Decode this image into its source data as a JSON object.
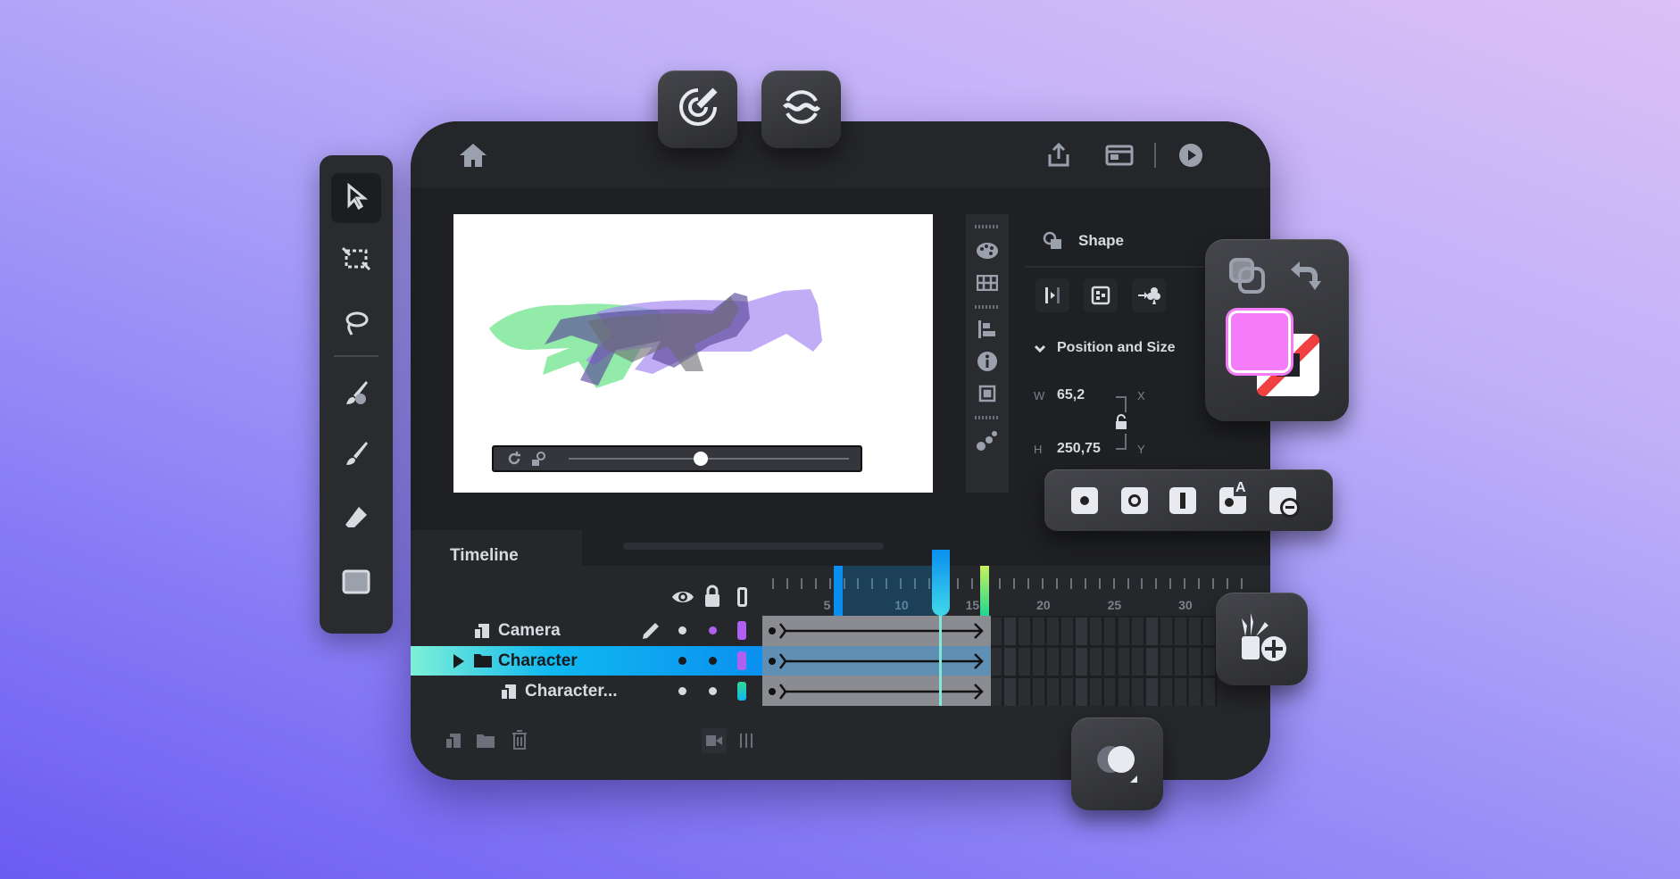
{
  "topbar": {
    "icons": [
      "home-icon",
      "share-icon",
      "window-icon",
      "play-icon"
    ]
  },
  "floating": {
    "top_buttons": [
      "target-pencil-icon",
      "wave-circle-icon"
    ],
    "add_brush_icon": "brush-add-icon",
    "shape_mode_icon": "shapes-icon"
  },
  "toolbar": {
    "tools": [
      "selection-icon",
      "transform-icon",
      "lasso-icon",
      "paint-brush-icon",
      "brush-icon",
      "eraser-icon",
      "rectangle-icon"
    ]
  },
  "properties": {
    "title": "Shape",
    "section": "Position and Size",
    "w_label": "W",
    "w_value": "65,2",
    "h_label": "H",
    "h_value": "250,75",
    "x_label": "X",
    "y_label": "Y"
  },
  "colors": {
    "fill": "#f47cf8",
    "stroke": "none",
    "accent": "#00b4ef"
  },
  "timeline": {
    "tab": "Timeline",
    "ruler": [
      "5",
      "10",
      "15",
      "20",
      "25",
      "30"
    ],
    "playhead_frame": 13,
    "layers": [
      {
        "name": "Camera",
        "selected": false,
        "color": "#b060f0"
      },
      {
        "name": "Character",
        "selected": true,
        "color": "#b060f0"
      },
      {
        "name": "Character...",
        "selected": false,
        "color": "#30d890"
      }
    ]
  }
}
